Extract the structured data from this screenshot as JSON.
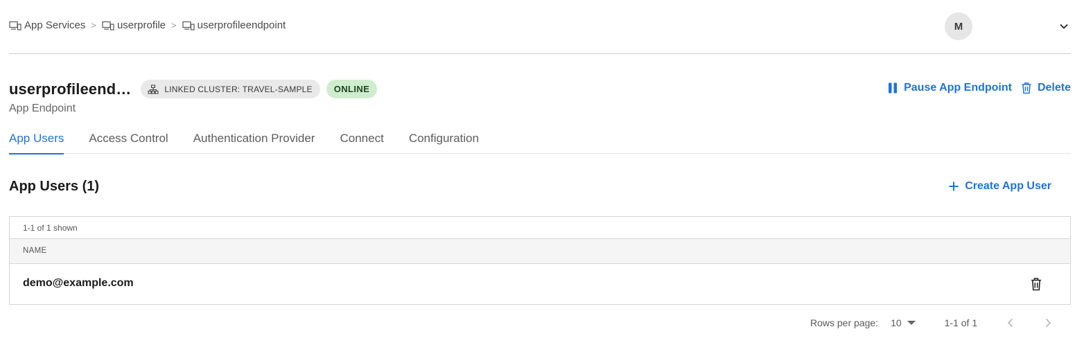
{
  "breadcrumb": {
    "items": [
      {
        "label": "App Services",
        "icon": "app-services-icon"
      },
      {
        "label": "userprofile",
        "icon": "app-services-icon"
      },
      {
        "label": "userprofileendpoint",
        "icon": "app-services-icon"
      }
    ],
    "separator": ">"
  },
  "account": {
    "avatar_initial": "M",
    "menu_icon": "chevron-down-icon"
  },
  "header": {
    "title": "userprofileend…",
    "subtitle": "App Endpoint",
    "cluster_badge": "LINKED CLUSTER: TRAVEL-SAMPLE",
    "status_badge": "ONLINE",
    "pause_label": "Pause App Endpoint",
    "delete_label": "Delete"
  },
  "tabs": [
    {
      "label": "App Users",
      "active": true
    },
    {
      "label": "Access Control",
      "active": false
    },
    {
      "label": "Authentication Provider",
      "active": false
    },
    {
      "label": "Connect",
      "active": false
    },
    {
      "label": "Configuration",
      "active": false
    }
  ],
  "section": {
    "title": "App Users (1)",
    "create_label": "Create App User"
  },
  "table": {
    "count_text": "1-1 of 1 shown",
    "columns": [
      "NAME"
    ],
    "rows": [
      {
        "name": "demo@example.com"
      }
    ]
  },
  "pagination": {
    "rows_label": "Rows per page:",
    "rows_value": "10",
    "range_text": "1-1 of 1"
  },
  "colors": {
    "accent": "#1f73d8",
    "online_bg": "#cfeccf",
    "online_text": "#1e4620",
    "badge_bg": "#e9e9e9"
  }
}
